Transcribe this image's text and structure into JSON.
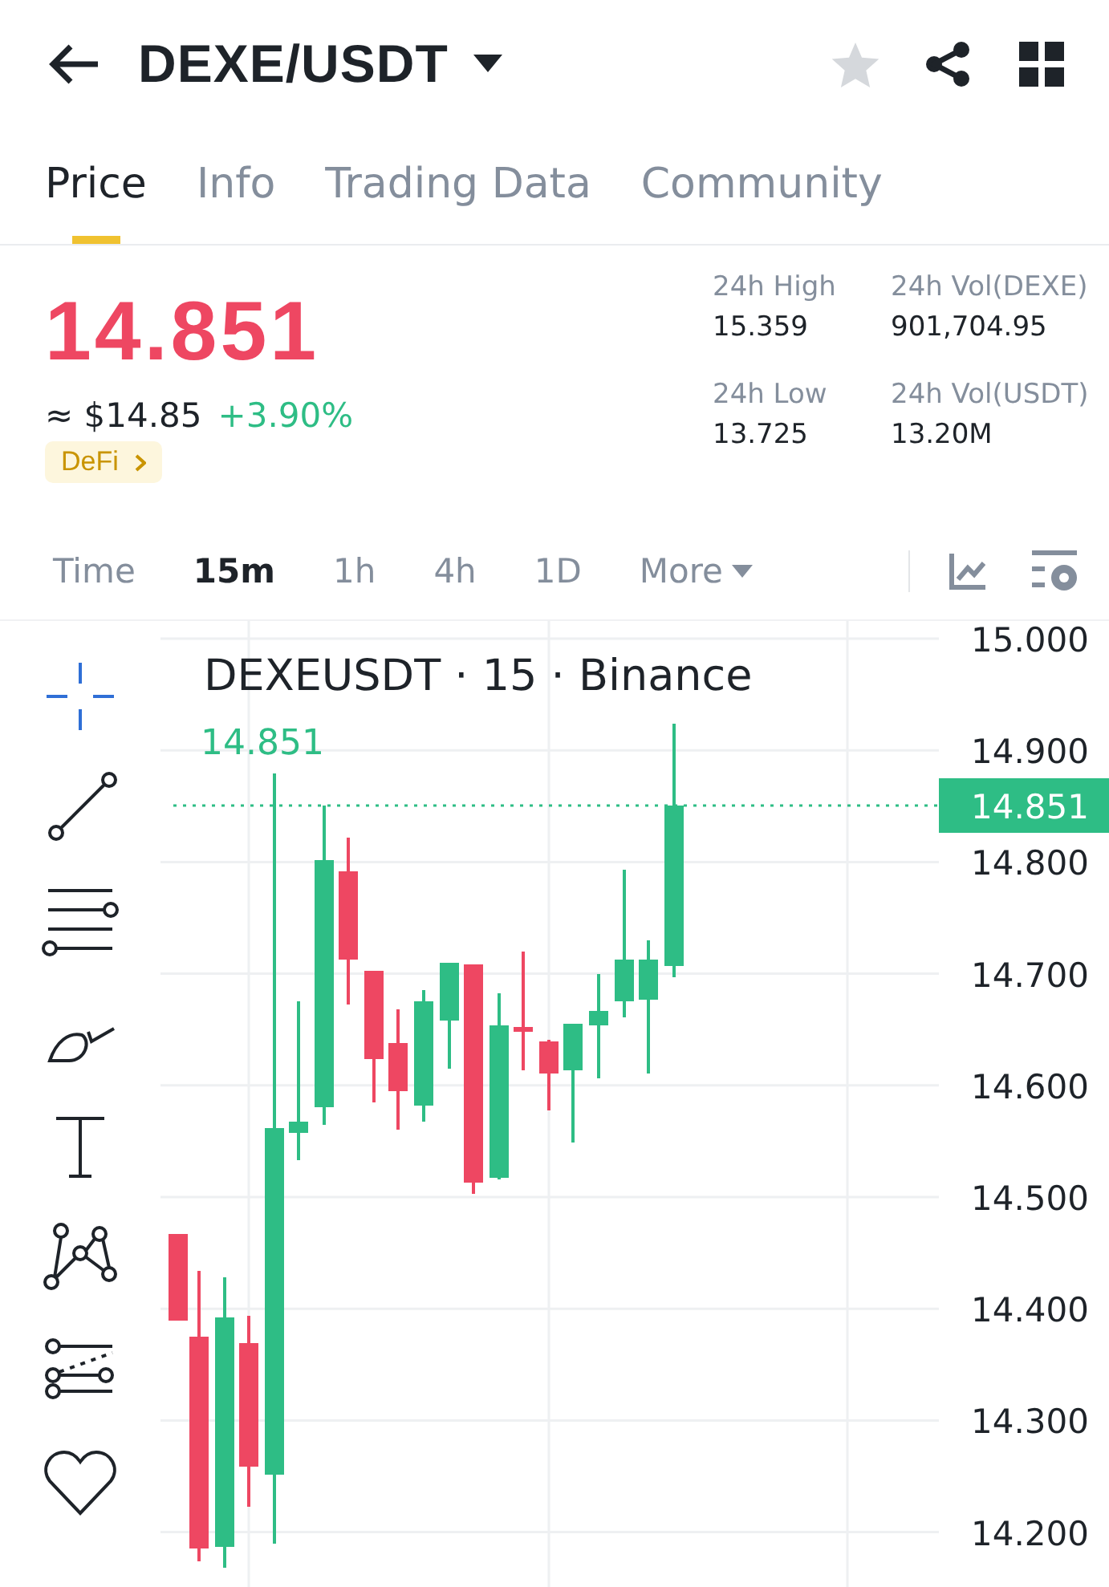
{
  "header": {
    "title": "DEXE/USDT",
    "favorite": false
  },
  "tabs": [
    {
      "label": "Price",
      "selected": true
    },
    {
      "label": "Info",
      "selected": false
    },
    {
      "label": "Trading Data",
      "selected": false
    },
    {
      "label": "Community",
      "selected": false
    }
  ],
  "price": {
    "last": "14.851",
    "fiat": "≈ $14.85",
    "change": "+3.90%",
    "tag": "DeFi"
  },
  "stats": [
    {
      "label": "24h High",
      "value": "15.359"
    },
    {
      "label": "24h Vol(DEXE)",
      "value": "901,704.95"
    },
    {
      "label": "24h Low",
      "value": "13.725"
    },
    {
      "label": "24h Vol(USDT)",
      "value": "13.20M"
    }
  ],
  "intervals": [
    {
      "label": "Time",
      "selected": false
    },
    {
      "label": "15m",
      "selected": true
    },
    {
      "label": "1h",
      "selected": false
    },
    {
      "label": "4h",
      "selected": false
    },
    {
      "label": "1D",
      "selected": false
    },
    {
      "label": "More",
      "selected": false
    }
  ],
  "chart": {
    "title": "DEXEUSDT · 15 · Binance",
    "last_label": "14.851",
    "price_tag": "14.851",
    "axis": [
      "15.000",
      "14.900",
      "14.800",
      "14.700",
      "14.600",
      "14.500",
      "14.400",
      "14.300",
      "14.200"
    ]
  }
}
